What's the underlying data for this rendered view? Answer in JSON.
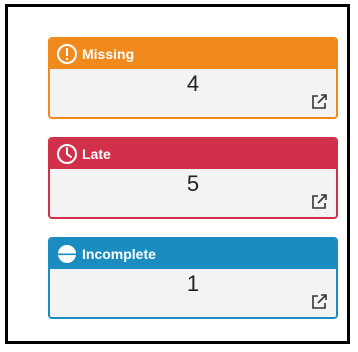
{
  "cards": [
    {
      "label": "Missing",
      "count": "4",
      "icon": "exclamation-circle-icon",
      "color": "#f08a1c"
    },
    {
      "label": "Late",
      "count": "5",
      "icon": "clock-icon",
      "color": "#d0304a"
    },
    {
      "label": "Incomplete",
      "count": "1",
      "icon": "half-circle-icon",
      "color": "#1b8cc0"
    }
  ]
}
